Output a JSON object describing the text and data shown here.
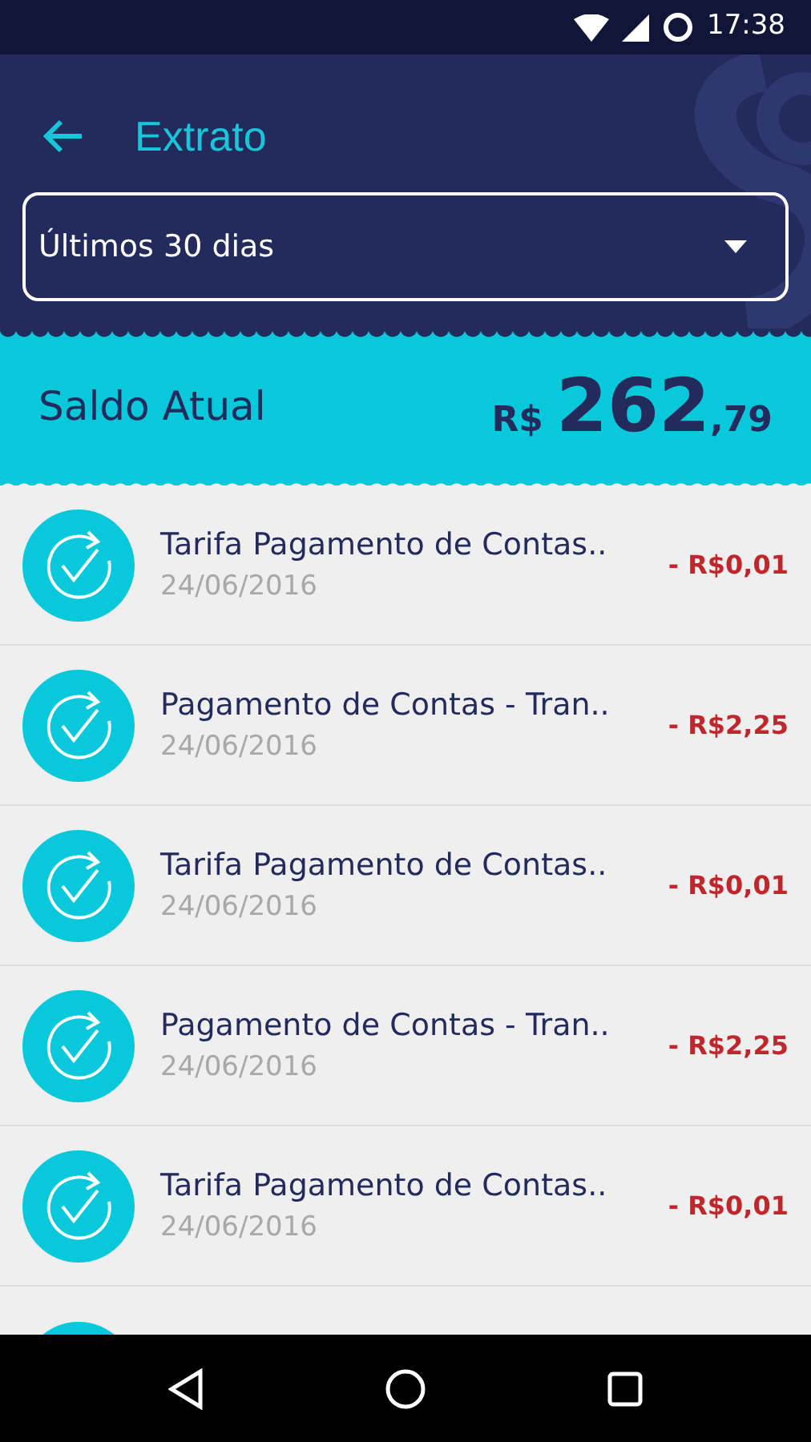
{
  "status_bar": {
    "time": "17:38"
  },
  "header": {
    "title": "Extrato"
  },
  "period_select": {
    "value": "Últimos 30 dias"
  },
  "balance": {
    "label": "Saldo Atual",
    "currency": "R$",
    "integer": "262",
    "cents": ",79"
  },
  "transactions": [
    {
      "title": "Tarifa Pagamento de Contas..",
      "date": "24/06/2016",
      "amount": "- R$0,01"
    },
    {
      "title": "Pagamento de Contas - Tran..",
      "date": "24/06/2016",
      "amount": "- R$2,25"
    },
    {
      "title": "Tarifa Pagamento de Contas..",
      "date": "24/06/2016",
      "amount": "- R$0,01"
    },
    {
      "title": "Pagamento de Contas - Tran..",
      "date": "24/06/2016",
      "amount": "- R$2,25"
    },
    {
      "title": "Tarifa Pagamento de Contas..",
      "date": "24/06/2016",
      "amount": "- R$0,01"
    },
    {
      "kind": "partial"
    }
  ]
}
